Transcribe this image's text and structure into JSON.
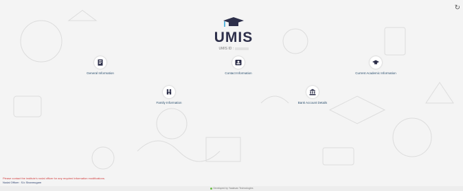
{
  "app": {
    "name": "UMIS",
    "id_label": "UMIS ID :"
  },
  "tiles": [
    {
      "label": "General Information",
      "icon": "document-icon"
    },
    {
      "label": "Contact Information",
      "icon": "contact-card-icon"
    },
    {
      "label": "Current Academic Information",
      "icon": "graduation-cap-icon"
    },
    {
      "label": "Family Information",
      "icon": "family-icon"
    },
    {
      "label": "Bank Account Details",
      "icon": "bank-icon"
    }
  ],
  "notice": "Please contact the institute's nodal officer for any required information modifications.",
  "nodal_officer": "Nodal Officer : S.k Shanmugam",
  "footer": "Developed by Yaalavan Technologies",
  "colors": {
    "brand": "#2d2f4a",
    "cap_tassel": "#2aa3d8",
    "label": "#2b4f6e",
    "notice": "#d23b3b"
  }
}
